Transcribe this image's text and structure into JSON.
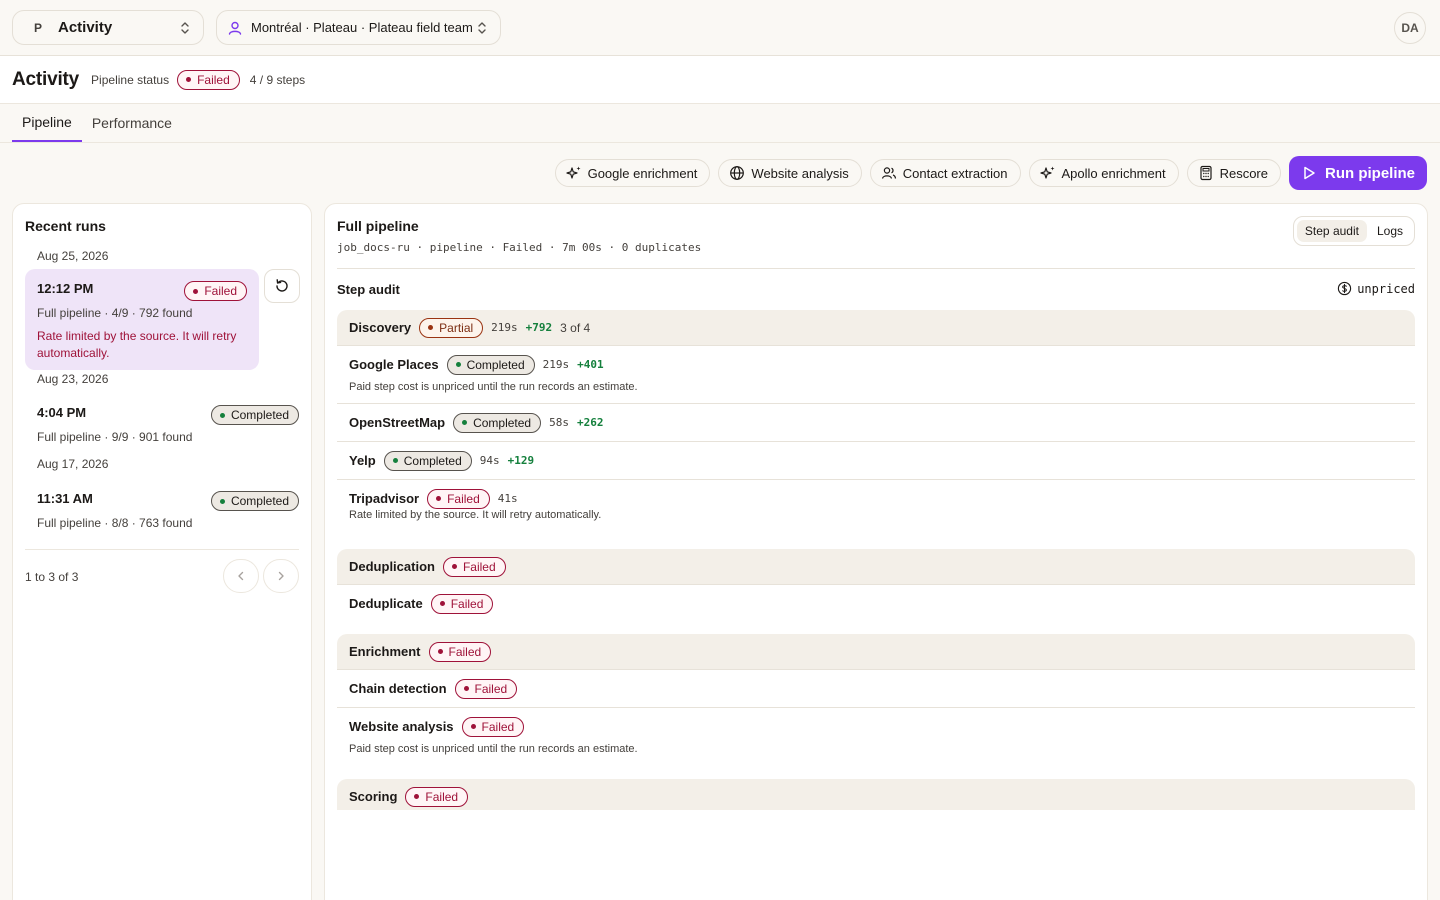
{
  "topbar": {
    "project_initial": "P",
    "project_name": "Activity",
    "team_name": "Montréal · Plateau · Plateau field team",
    "user_initials": "DA"
  },
  "header": {
    "title": "Activity",
    "status_label": "Pipeline status",
    "status": "Failed",
    "steps": "4 / 9 steps"
  },
  "tabs": [
    {
      "label": "Pipeline",
      "active": true
    },
    {
      "label": "Performance",
      "active": false
    }
  ],
  "actions": {
    "google": "Google enrichment",
    "website": "Website analysis",
    "contact": "Contact extraction",
    "apollo": "Apollo enrichment",
    "rescore": "Rescore",
    "run": "Run pipeline"
  },
  "runs": {
    "title": "Recent runs",
    "items": [
      {
        "date": "Aug 25, 2026",
        "time": "12:12 PM",
        "status": "Failed",
        "meta": "Full pipeline · 4/9 · 792 found",
        "error": "Rate limited by the source. It will retry automatically."
      },
      {
        "date": "Aug 23, 2026",
        "time": "4:04 PM",
        "status": "Completed",
        "meta": "Full pipeline · 9/9 · 901 found"
      },
      {
        "date": "Aug 17, 2026",
        "time": "11:31 AM",
        "status": "Completed",
        "meta": "Full pipeline · 8/8 · 763 found"
      }
    ],
    "pager": "1 to 3 of 3"
  },
  "detail": {
    "title": "Full pipeline",
    "subtitle": "job_docs-ru · pipeline · Failed · 7m 00s · 0 duplicates",
    "seg_audit": "Step audit",
    "seg_logs": "Logs",
    "audit_title": "Step audit",
    "unpriced": "unpriced",
    "groups": {
      "discovery": {
        "name": "Discovery",
        "status": "Partial",
        "dur": "219s",
        "gain": "+792",
        "count": "3 of 4"
      },
      "dedup": {
        "name": "Deduplication",
        "status": "Failed"
      },
      "enrich": {
        "name": "Enrichment",
        "status": "Failed"
      },
      "scoring": {
        "name": "Scoring",
        "status": "Failed"
      }
    },
    "steps": {
      "google_places": {
        "name": "Google Places",
        "status": "Completed",
        "dur": "219s",
        "gain": "+401",
        "note": "Paid step cost is unpriced until the run records an estimate."
      },
      "osm": {
        "name": "OpenStreetMap",
        "status": "Completed",
        "dur": "58s",
        "gain": "+262"
      },
      "yelp": {
        "name": "Yelp",
        "status": "Completed",
        "dur": "94s",
        "gain": "+129"
      },
      "tripadvisor": {
        "name": "Tripadvisor",
        "status": "Failed",
        "dur": "41s",
        "note": "Rate limited by the source. It will retry automatically."
      },
      "dedupe": {
        "name": "Deduplicate",
        "status": "Failed"
      },
      "chain": {
        "name": "Chain detection",
        "status": "Failed"
      },
      "website": {
        "name": "Website analysis",
        "status": "Failed",
        "note": "Paid step cost is unpriced until the run records an estimate."
      }
    }
  },
  "colors": {
    "accent": "#7c3aed",
    "failed": "#9f1239",
    "completed_dot": "#15803d",
    "partial": "#9a3412"
  }
}
